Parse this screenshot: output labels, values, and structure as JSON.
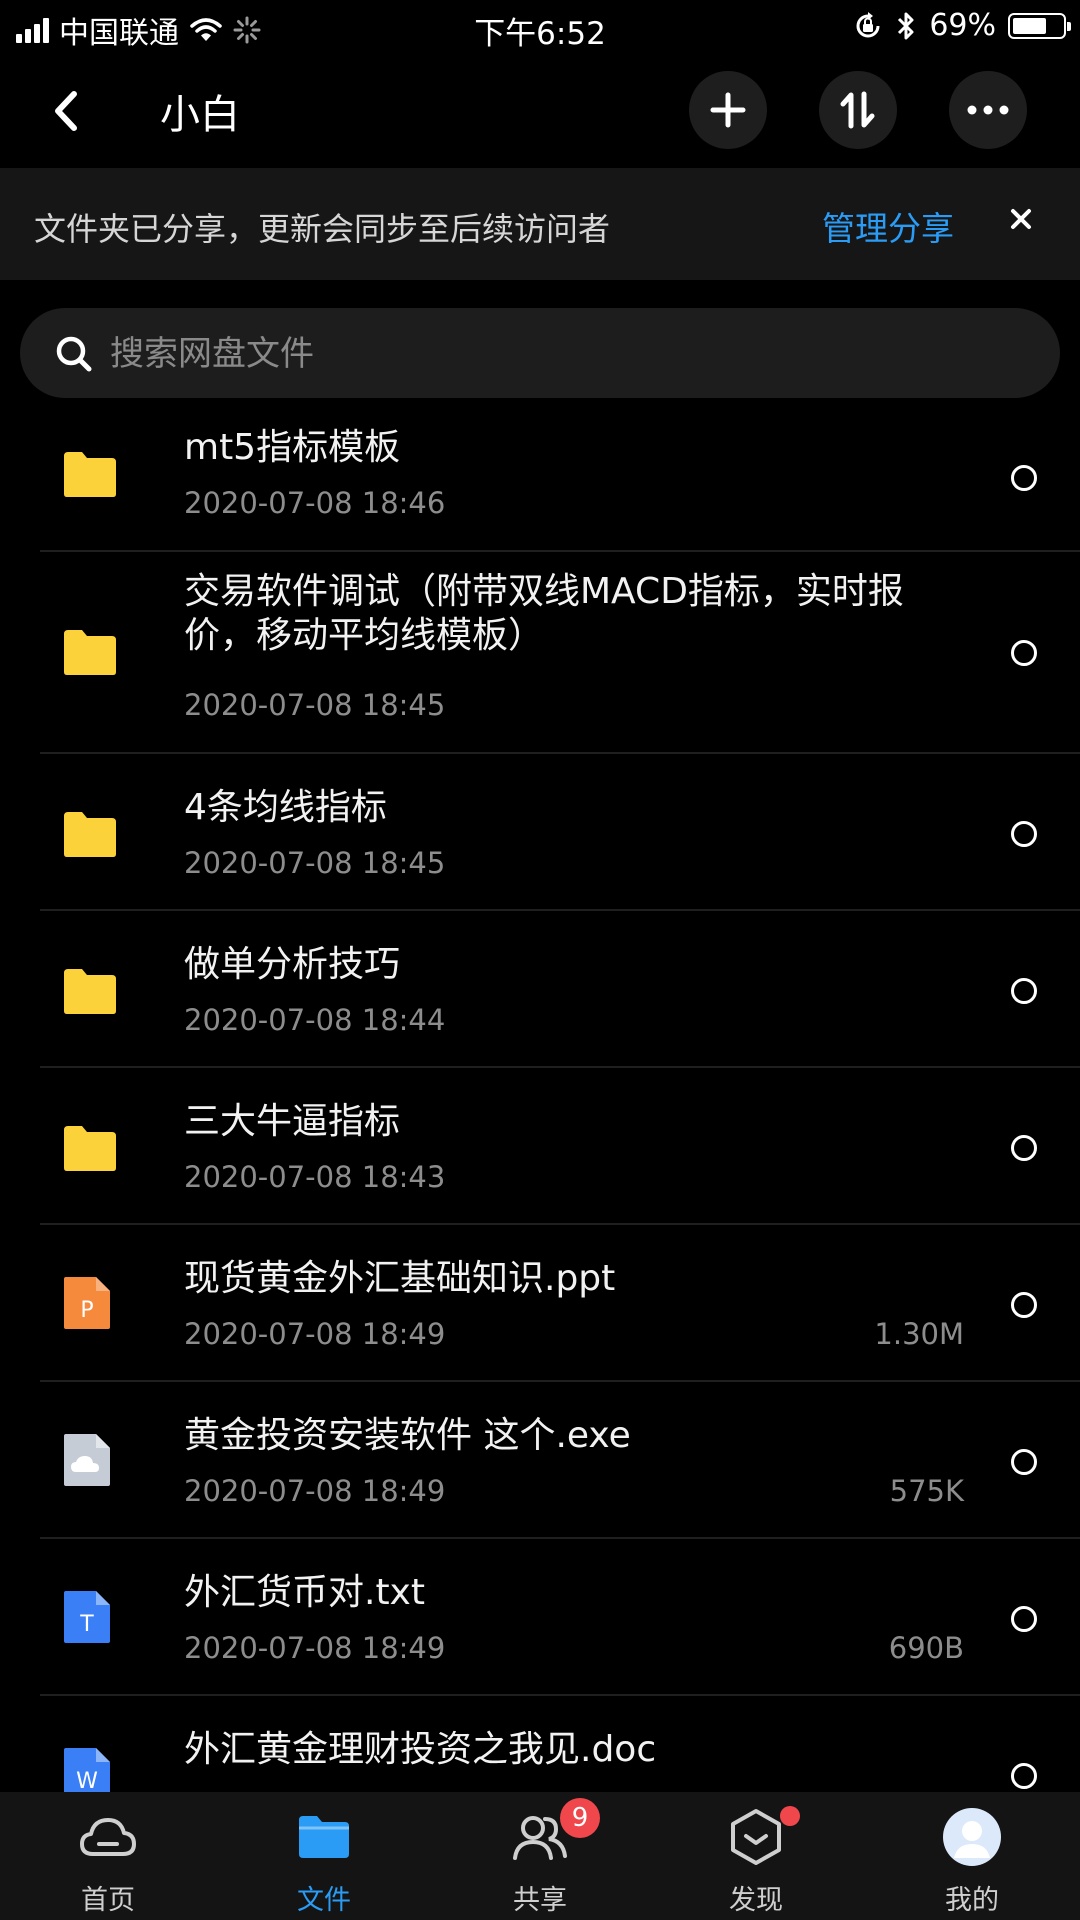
{
  "status_bar": {
    "carrier": "中国联通",
    "time": "下午6:52",
    "battery_percent": "69%",
    "battery_level": 0.69
  },
  "nav": {
    "title": "小白",
    "icons": [
      "back-icon",
      "plus-icon",
      "sort-icon",
      "more-icon"
    ]
  },
  "banner": {
    "text": "文件夹已分享，更新会同步至后续访问者",
    "link": "管理分享"
  },
  "search": {
    "placeholder": "搜索网盘文件"
  },
  "files": [
    {
      "name": "mt5指标模板",
      "date": "2020-07-08 18:46",
      "size": "",
      "type": "folder"
    },
    {
      "name": "交易软件调试（附带双线MACD指标，实时报价，移动平均线模板）",
      "date": "2020-07-08 18:45",
      "size": "",
      "type": "folder"
    },
    {
      "name": "4条均线指标",
      "date": "2020-07-08 18:45",
      "size": "",
      "type": "folder"
    },
    {
      "name": "做单分析技巧",
      "date": "2020-07-08 18:44",
      "size": "",
      "type": "folder"
    },
    {
      "name": "三大牛逼指标",
      "date": "2020-07-08 18:43",
      "size": "",
      "type": "folder"
    },
    {
      "name": "现货黄金外汇基础知识.ppt",
      "date": "2020-07-08 18:49",
      "size": "1.30M",
      "type": "ppt"
    },
    {
      "name": "黄金投资安装软件 这个.exe",
      "date": "2020-07-08 18:49",
      "size": "575K",
      "type": "exe"
    },
    {
      "name": "外汇货币对.txt",
      "date": "2020-07-08 18:49",
      "size": "690B",
      "type": "txt"
    },
    {
      "name": "外汇黄金理财投资之我见.doc",
      "date": "",
      "size": "",
      "type": "doc"
    }
  ],
  "tabs": [
    {
      "label": "首页",
      "icon": "cloud-icon",
      "active": false
    },
    {
      "label": "文件",
      "icon": "folder-icon",
      "active": true
    },
    {
      "label": "共享",
      "icon": "people-icon",
      "active": false,
      "badge": "9"
    },
    {
      "label": "发现",
      "icon": "discover-icon",
      "active": false,
      "dot": true
    },
    {
      "label": "我的",
      "icon": "avatar-icon",
      "active": false
    }
  ],
  "colors": {
    "accent": "#2a9cf5",
    "folder": "#fcd23b",
    "ppt": "#f58a3c",
    "txt": "#3a7ff6",
    "exe": "#c5ccd6",
    "badge": "#f0474d"
  }
}
